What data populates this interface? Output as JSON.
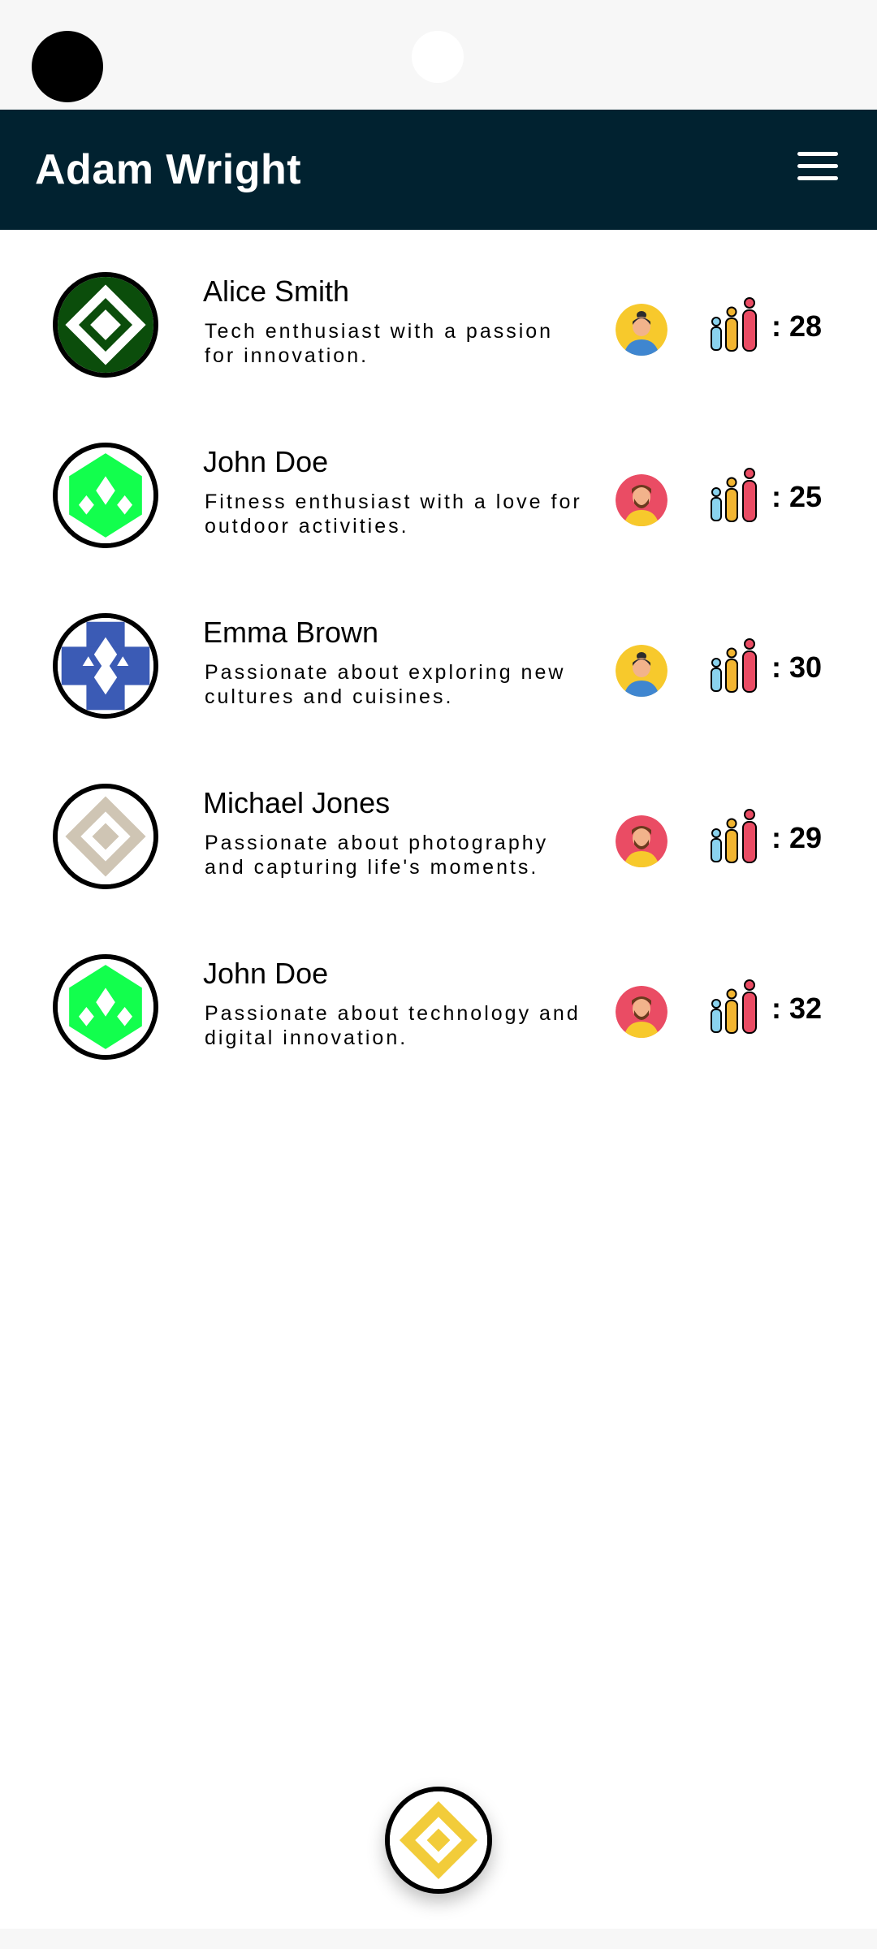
{
  "header": {
    "title": "Adam Wright",
    "menu_icon": "hamburger-menu-icon",
    "background": "#012230"
  },
  "people": [
    {
      "name": "Alice Smith",
      "bio": "Tech enthusiast with a passion for innovation.",
      "age": ": 28",
      "avatar_color": "#0b4d0b",
      "avatar_icon": "pattern-avatar-icon",
      "gender_icon": "female-person-icon"
    },
    {
      "name": "John Doe",
      "bio": "Fitness enthusiast with a love for outdoor activities.",
      "age": ": 25",
      "avatar_color": "#12ff4d",
      "avatar_icon": "pattern-avatar-icon",
      "gender_icon": "male-person-icon"
    },
    {
      "name": "Emma Brown",
      "bio": "Passionate about exploring new cultures and cuisines.",
      "age": ": 30",
      "avatar_color": "#3b5bb5",
      "avatar_icon": "pattern-avatar-icon",
      "gender_icon": "female-person-icon"
    },
    {
      "name": "Michael Jones",
      "bio": "Passionate about photography and capturing life's moments.",
      "age": ": 29",
      "avatar_color": "#cfc5b4",
      "avatar_icon": "pattern-avatar-icon",
      "gender_icon": "male-person-icon"
    },
    {
      "name": "John Doe",
      "bio": "Passionate about technology and digital innovation.",
      "age": ": 32",
      "avatar_color": "#12ff4d",
      "avatar_icon": "pattern-avatar-icon",
      "gender_icon": "male-person-icon"
    }
  ],
  "fab": {
    "icon": "pattern-avatar-icon",
    "color": "#f2cc3a"
  }
}
